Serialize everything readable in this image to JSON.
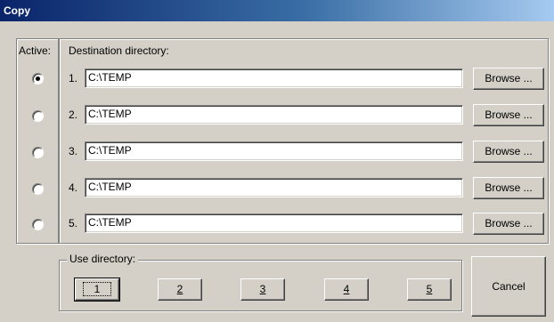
{
  "window": {
    "title": "Copy"
  },
  "active_header": "Active:",
  "destination_header": "Destination directory:",
  "rows": [
    {
      "number": "1.",
      "path": "C:\\TEMP",
      "browse_label": "Browse ...",
      "selected": true
    },
    {
      "number": "2.",
      "path": "C:\\TEMP",
      "browse_label": "Browse ...",
      "selected": false
    },
    {
      "number": "3.",
      "path": "C:\\TEMP",
      "browse_label": "Browse ...",
      "selected": false
    },
    {
      "number": "4.",
      "path": "C:\\TEMP",
      "browse_label": "Browse ...",
      "selected": false
    },
    {
      "number": "5.",
      "path": "C:\\TEMP",
      "browse_label": "Browse ...",
      "selected": false
    }
  ],
  "use_directory": {
    "legend": "Use directory:",
    "buttons": [
      "1",
      "2",
      "3",
      "4",
      "5"
    ],
    "focused": "1"
  },
  "cancel_label": "Cancel"
}
